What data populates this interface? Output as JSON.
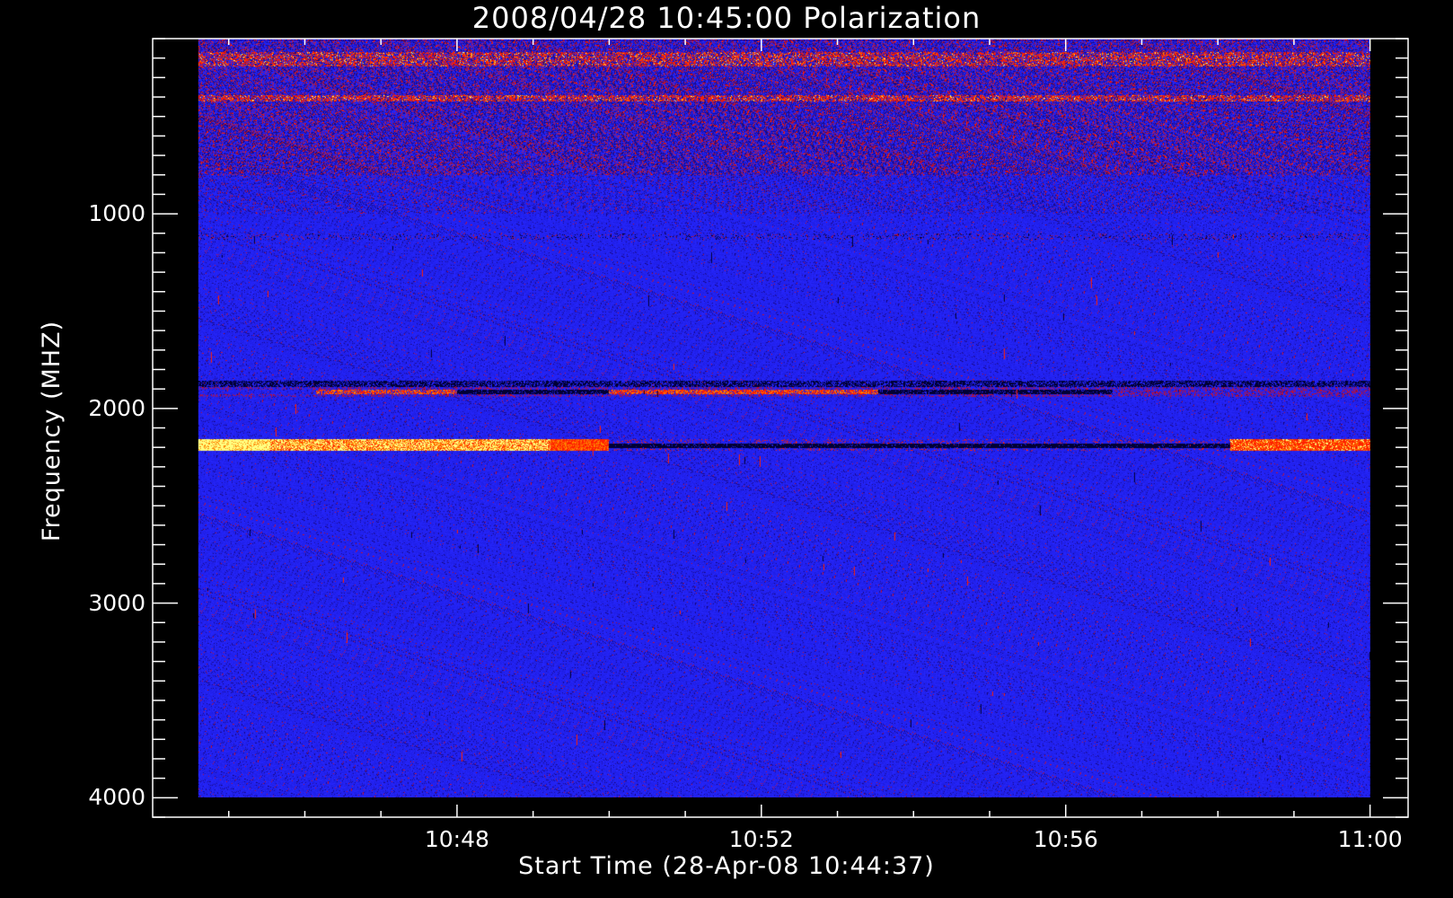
{
  "chart_data": {
    "type": "heatmap",
    "title": "2008/04/28 10:45:00 Polarization",
    "xlabel": "Start Time (28-Apr-08 10:44:37)",
    "ylabel": "Frequency (MHZ)",
    "x_range_minutes": [
      44.0,
      60.5
    ],
    "data_x_range_minutes": [
      44.6,
      60.0
    ],
    "y_range_mhz": [
      100,
      4100
    ],
    "data_y_range_mhz": [
      100,
      4000
    ],
    "y_reversed": true,
    "x_ticks": [
      {
        "minute": 48,
        "label": "10:48"
      },
      {
        "minute": 52,
        "label": "10:52"
      },
      {
        "minute": 56,
        "label": "10:56"
      },
      {
        "minute": 60,
        "label": "11:00"
      }
    ],
    "y_ticks": [
      {
        "value": 1000,
        "label": "1000"
      },
      {
        "value": 2000,
        "label": "2000"
      },
      {
        "value": 3000,
        "label": "3000"
      },
      {
        "value": 4000,
        "label": "4000"
      }
    ],
    "colors": {
      "background": "#000000",
      "axes": "#ffffff",
      "base": "#2222f0",
      "noise_dark": "#1a0a8a",
      "noise_red": "#c01030",
      "hot_red": "#ff2000",
      "hot_orange": "#ff8000",
      "hot_yellow": "#ffff80",
      "cold": "#000033"
    },
    "features": [
      {
        "name": "noisy band",
        "freq_start": 100,
        "freq_end": 800,
        "kind": "noise"
      },
      {
        "name": "hot band 200 MHz",
        "freq_start": 170,
        "freq_end": 240,
        "kind": "hot",
        "strength": 0.6
      },
      {
        "name": "hot band 400 MHz",
        "freq_start": 390,
        "freq_end": 420,
        "kind": "hot",
        "strength": 0.7
      },
      {
        "name": "dashed band 1100 MHz",
        "freq_start": 1100,
        "freq_end": 1130,
        "kind": "dashed"
      },
      {
        "name": "band 1870 MHz",
        "freq_start": 1860,
        "freq_end": 1885,
        "kind": "dark_line"
      },
      {
        "name": "band 1900 MHz",
        "freq_start": 1890,
        "freq_end": 1935,
        "kind": "mixed"
      },
      {
        "name": "bright band 2200 MHz",
        "freq_start": 2160,
        "freq_end": 2215,
        "kind": "bright"
      }
    ]
  }
}
